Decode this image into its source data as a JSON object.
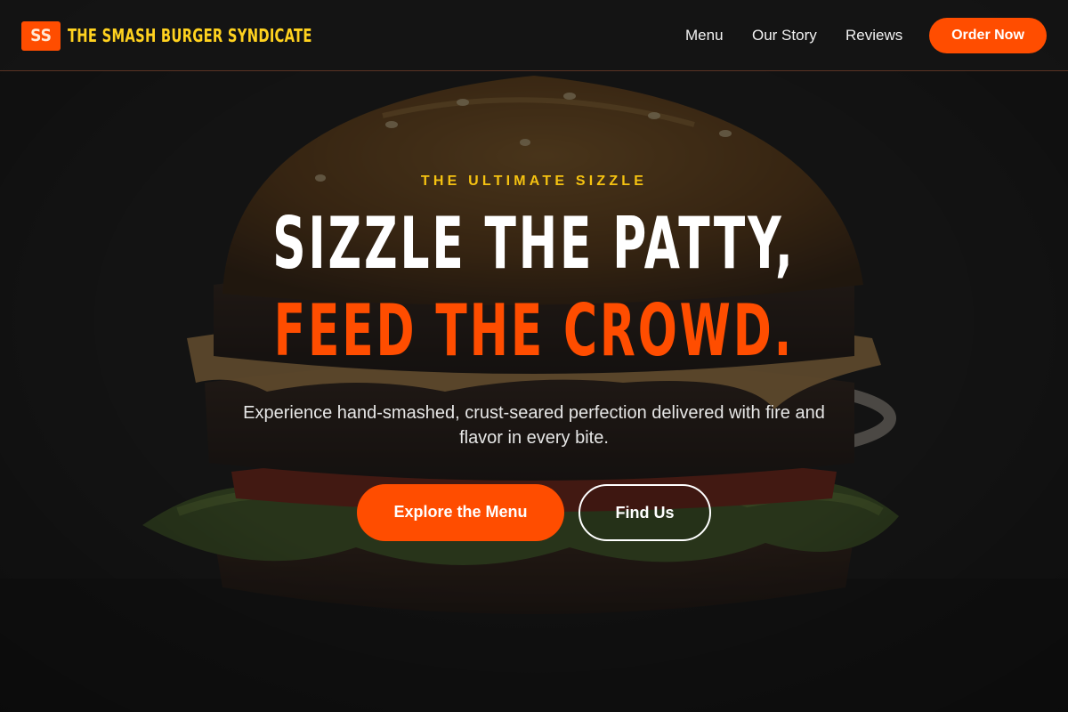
{
  "header": {
    "logo_badge": "SS",
    "brand_name": "THE SMASH BURGER SYNDICATE",
    "nav": [
      {
        "label": "Menu"
      },
      {
        "label": "Our Story"
      },
      {
        "label": "Reviews"
      }
    ],
    "cta_label": "Order Now"
  },
  "hero": {
    "eyebrow": "THE ULTIMATE SIZZLE",
    "headline_line1": "SIZZLE THE PATTY,",
    "headline_line2": "FEED THE CROWD.",
    "subtext": "Experience hand-smashed, crust-seared perfection delivered with fire and flavor in every bite.",
    "primary_button": "Explore the Menu",
    "secondary_button": "Find Us",
    "background_image": "burger-photo"
  },
  "colors": {
    "accent": "#ff4d00",
    "brand_yellow": "#ffd21f",
    "eyebrow_yellow": "#f5c211",
    "background": "#161616"
  }
}
